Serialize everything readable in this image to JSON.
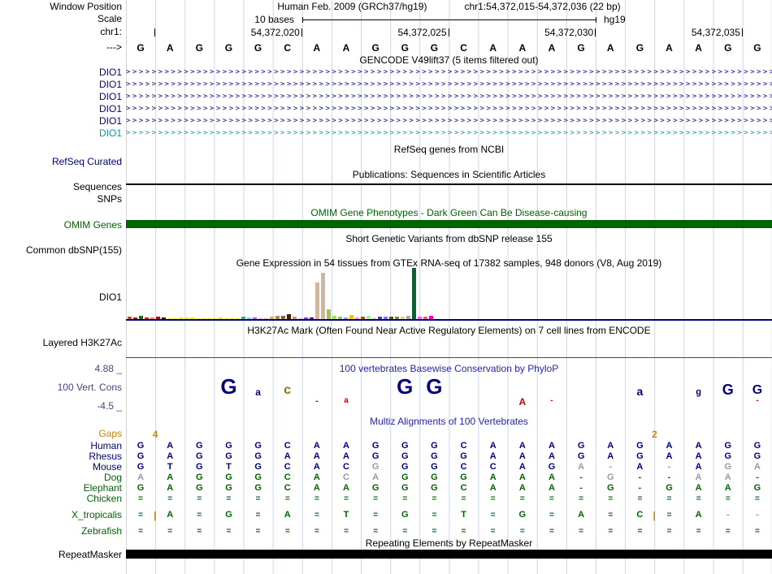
{
  "colors": {
    "navy": "#000080",
    "teal": "#0099AA",
    "green": "#006400",
    "gray": "#999999",
    "orange": "#C8860B",
    "red": "#CC0000",
    "olive": "#7A7A00",
    "title_blue": "#2222BB",
    "axis": "#444488",
    "grid": "#CBD5EA",
    "omim_bar": "#006400",
    "gtex_baseline": "#000080",
    "h3k27ac_line": "#7A3535",
    "sequences_line": "#000000",
    "repeat_bar": "#000000"
  },
  "header": {
    "assembly_title": "Human Feb. 2009 (GRCh37/hg19)",
    "position_title": "chr1:54,372,015-54,372,036 (22 bp)"
  },
  "left_labels": {
    "window_position": "Window Position",
    "scale": "Scale",
    "chrom": "chr1:",
    "strand": "--->",
    "refseq_curated": "RefSeq Curated",
    "sequences": "Sequences",
    "snps": "SNPs",
    "omim": "OMIM Genes",
    "dbsnp": "Common dbSNP(155)",
    "gtex_gene": "DIO1",
    "h3k27ac": "Layered H3K27Ac",
    "phylop_max": "4.88 _",
    "phylop_track": "100 Vert. Cons",
    "phylop_min": "-4.5 _",
    "gaps": "Gaps",
    "repeatmasker": "RepeatMasker"
  },
  "ruler": {
    "scale_text": "10 bases",
    "assembly": "hg19",
    "ticks": [
      {
        "boundary": 1,
        "label": ""
      },
      {
        "boundary": 6,
        "label": "54,372,020"
      },
      {
        "boundary": 11,
        "label": "54,372,025"
      },
      {
        "boundary": 16,
        "label": "54,372,030"
      },
      {
        "boundary": 21,
        "label": "54,372,035"
      }
    ]
  },
  "sequence": {
    "bases": [
      "G",
      "A",
      "G",
      "G",
      "G",
      "C",
      "A",
      "A",
      "G",
      "G",
      "G",
      "C",
      "A",
      "A",
      "A",
      "G",
      "A",
      "G",
      "A",
      "A",
      "G",
      "G"
    ]
  },
  "titles": {
    "gencode": "GENCODE V49lift37 (5 items filtered out)",
    "refseq": "RefSeq genes from NCBI",
    "publications": "Publications: Sequences in Scientific Articles",
    "omim": "OMIM Gene Phenotypes - Dark Green Can Be Disease-causing",
    "dbsnp": "Short Genetic Variants from dbSNP release 155",
    "gtex": "Gene Expression in 54 tissues from GTEx RNA-seq of 17382 samples, 948 donors (V8, Aug 2019)",
    "h3k27ac": "H3K27Ac Mark (Often Found Near Active Regulatory Elements) on 7 cell lines from ENCODE",
    "phylop": "100 vertebrates Basewise Conservation by PhyloP",
    "multiz": "Multiz Alignments of 100 Vertebrates",
    "repeatmasker": "Repeating Elements by RepeatMasker"
  },
  "gencode": {
    "items": [
      {
        "label": "DIO1",
        "color": "navy"
      },
      {
        "label": "DIO1",
        "color": "navy"
      },
      {
        "label": "DIO1",
        "color": "navy"
      },
      {
        "label": "DIO1",
        "color": "navy"
      },
      {
        "label": "DIO1",
        "color": "navy"
      },
      {
        "label": "DIO1",
        "color": "teal"
      }
    ]
  },
  "gtex": {
    "bars": [
      [
        3,
        "#CC4422"
      ],
      [
        2,
        "#882211"
      ],
      [
        4,
        "#226622"
      ],
      [
        2,
        "#CC2222"
      ],
      [
        2,
        "#DD8877"
      ],
      [
        3,
        "#BB0000"
      ],
      [
        2,
        "#550000"
      ],
      [
        1,
        "#EEEE00"
      ],
      [
        1,
        "#EEEE00"
      ],
      [
        2,
        "#EEEE00"
      ],
      [
        2,
        "#EEEE00"
      ],
      [
        2,
        "#EEEE00"
      ],
      [
        1,
        "#EEEE00"
      ],
      [
        1,
        "#EEEE00"
      ],
      [
        1,
        "#EEEE00"
      ],
      [
        1,
        "#EEEE00"
      ],
      [
        2,
        "#EEEE00"
      ],
      [
        1,
        "#EEEE00"
      ],
      [
        1,
        "#EEEE00"
      ],
      [
        1,
        "#EEEE00"
      ],
      [
        3,
        "#33AAAA"
      ],
      [
        2,
        "#88CCEE"
      ],
      [
        2,
        "#AA66CC"
      ],
      [
        1,
        "#EEAACC"
      ],
      [
        1,
        "#CCAADD"
      ],
      [
        3,
        "#DDAA66"
      ],
      [
        4,
        "#BB8844"
      ],
      [
        4,
        "#886644"
      ],
      [
        6,
        "#442200"
      ],
      [
        3,
        "#BB9988"
      ],
      [
        1,
        "#EEAACC"
      ],
      [
        2,
        "#8844CC"
      ],
      [
        2,
        "#660099"
      ],
      [
        45,
        "#CDB79E"
      ],
      [
        57,
        "#CDB79E"
      ],
      [
        12,
        "#AABB66"
      ],
      [
        4,
        "#99EE44"
      ],
      [
        3,
        "#99BB88"
      ],
      [
        2,
        "#9999EE"
      ],
      [
        5,
        "#EEC900"
      ],
      [
        2,
        "#EE99DD"
      ],
      [
        3,
        "#995522"
      ],
      [
        4,
        "#AAEE99"
      ],
      [
        2,
        "#DDDDDD"
      ],
      [
        3,
        "#3344DD"
      ],
      [
        3,
        "#7777EE"
      ],
      [
        3,
        "#555522"
      ],
      [
        3,
        "#778855"
      ],
      [
        3,
        "#EECC88"
      ],
      [
        4,
        "#AAAAAA"
      ],
      [
        63,
        "#006633"
      ],
      [
        3,
        "#EE66EE"
      ],
      [
        3,
        "#EE5599"
      ],
      [
        4,
        "#EE00BB"
      ]
    ]
  },
  "phylop": {
    "glyphs": [
      {
        "col": 3,
        "ch": "G",
        "cl": "navy",
        "size": 26,
        "below": false
      },
      {
        "col": 4,
        "ch": "a",
        "cl": "navy",
        "size": 12,
        "below": false
      },
      {
        "col": 5,
        "ch": "c",
        "cl": "olive",
        "size": 16,
        "below": false
      },
      {
        "col": 6,
        "ch": "-",
        "cl": "red",
        "size": 11,
        "below": true
      },
      {
        "col": 7,
        "ch": "a",
        "cl": "red",
        "size": 10,
        "below": true
      },
      {
        "col": 9,
        "ch": "G",
        "cl": "navy",
        "size": 26,
        "below": false
      },
      {
        "col": 10,
        "ch": "G",
        "cl": "navy",
        "size": 26,
        "below": false
      },
      {
        "col": 13,
        "ch": "A",
        "cl": "red",
        "size": 12,
        "below": true
      },
      {
        "col": 14,
        "ch": "-",
        "cl": "red",
        "size": 10,
        "below": true
      },
      {
        "col": 17,
        "ch": "a",
        "cl": "navy",
        "size": 14,
        "below": false
      },
      {
        "col": 19,
        "ch": "g",
        "cl": "navy",
        "size": 11,
        "below": false
      },
      {
        "col": 20,
        "ch": "G",
        "cl": "navy",
        "size": 18,
        "below": false
      },
      {
        "col": 21,
        "ch": "G",
        "cl": "navy",
        "size": 16,
        "below": false
      },
      {
        "col": 21,
        "ch": "-",
        "cl": "red",
        "size": 10,
        "below": true
      }
    ]
  },
  "multiz": {
    "gaps": {
      "markers": [
        {
          "boundary": 1,
          "count": "4"
        },
        {
          "boundary": 18,
          "count": "2"
        }
      ]
    },
    "insert_pipes": [
      1,
      18
    ],
    "rows": [
      {
        "name": "Human",
        "color": "n",
        "seq": "GAGGGCAAGGGCAAAGAGAAGG",
        "cls": "nnnnnnnnnnnnnnnnnnnnnn"
      },
      {
        "name": "Rhesus",
        "color": "n",
        "seq": "GAGGGAAAGGGGAAAGAGAAGG",
        "cls": "nnnnnnnnnnnnnnnnnnnnnn"
      },
      {
        "name": "Mouse",
        "color": "n",
        "seq": "GTGTGCACGGGCCAGA-A-AGA",
        "cls": "nnnnnnnngnnnnnnggngngg"
      },
      {
        "name": "Dog",
        "color": "e",
        "seq": "AAGGGCACAGGGAAA-G--AA-",
        "cls": "geeeeeeggeeeeeeegeegge"
      },
      {
        "name": "Elephant",
        "color": "e",
        "seq": "GAGGGCAAGGGCAAA-G-GAAG",
        "cls": "eeeeeeeeeeeeeeeeeeeeee"
      },
      {
        "name": "Chicken",
        "color": "e",
        "seq": "======================",
        "cls": "eeeeeeeeeeeeeeeeeeeeee"
      },
      {
        "name": "X_tropicalis",
        "color": "e",
        "seq": "=A=G=A=T=G=T=G=A=C=A--",
        "cls": "eeeeeeeeeeeeeeeeeeeegg"
      },
      {
        "name": "Zebrafish",
        "color": "e",
        "seq": "======================",
        "cls": "eeeeeeeeeeeeeeeeeeeeee"
      }
    ]
  }
}
